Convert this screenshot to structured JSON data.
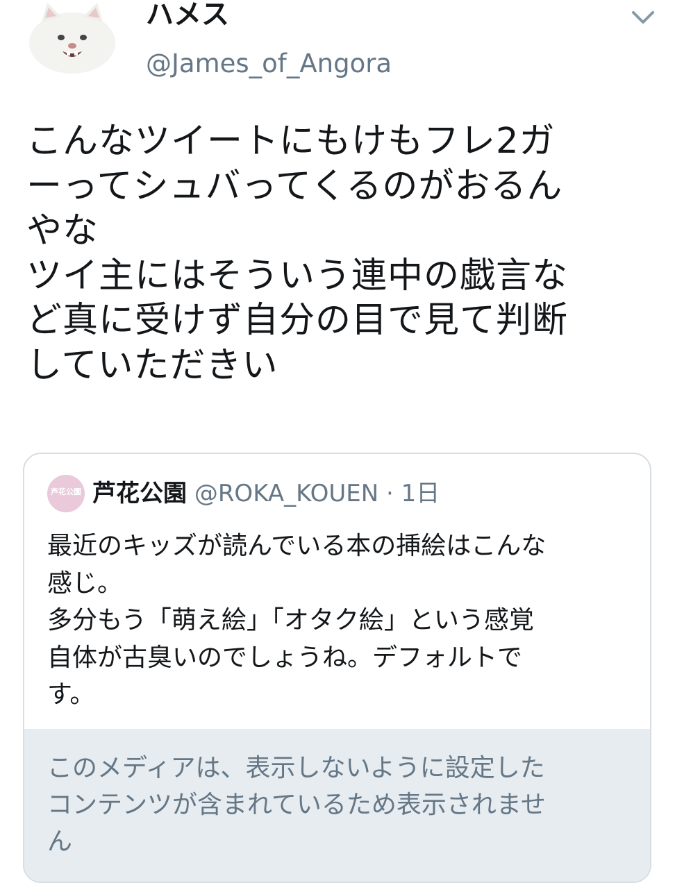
{
  "author": {
    "display_name": "ハメス",
    "handle": "@James_of_Angora",
    "avatar_icon": "white-cat-avatar"
  },
  "tweet": {
    "text": "こんなツイートにもけもフレ2ガ\nーってシュバってくるのがおるん\nやな\nツイ主にはそういう連中の戯言な\nど真に受けず自分の目で見て判断\nしていただきい"
  },
  "quoted_tweet": {
    "author_name": "芦花公園",
    "author_handle": "@ROKA_KOUEN",
    "separator": "·",
    "time": "1日",
    "avatar_text": "芦花公園",
    "text": "最近のキッズが読んでいる本の挿絵はこんな\n感じ。\n多分もう「萌え絵」「オタク絵」という感覚\n自体が古臭いのでしょうね。デフォルトで\nす。",
    "media_notice": "このメディアは、表示しないように設定した\nコンテンツが含まれているため表示されませ\nん"
  },
  "colors": {
    "text_primary": "#14171a",
    "text_secondary": "#657786",
    "border": "#d7dde2",
    "notice_bg": "#e6ecf0"
  }
}
